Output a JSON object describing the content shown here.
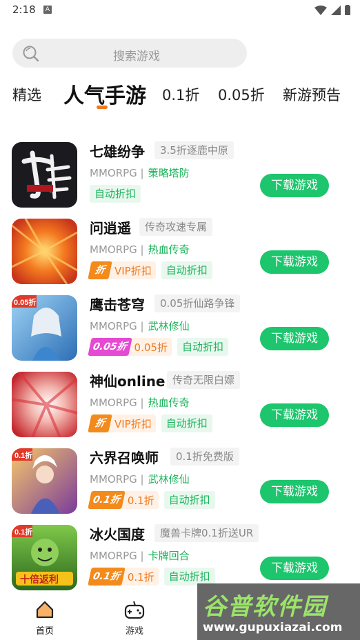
{
  "status_bar": {
    "time": "2:18",
    "notification_icon": "A"
  },
  "search": {
    "placeholder": "搜索游戏"
  },
  "tabs": [
    {
      "label": "精选"
    },
    {
      "label": "人气手游",
      "active": true
    },
    {
      "label": "0.1折"
    },
    {
      "label": "0.05折"
    },
    {
      "label": "新游预告"
    }
  ],
  "colors": {
    "accent": "#f07a1e",
    "green": "#1dc56d",
    "tag_green": "#1bb35a"
  },
  "games": [
    {
      "name": "七雄纷争",
      "tag": "3.5折逐鹿中原",
      "type": "MMORPG |",
      "genre": "策略塔防",
      "badge": "",
      "badge_value": "",
      "auto": "自动折扣",
      "button": "下载游戏",
      "icon": "qixiong-game-icon"
    },
    {
      "name": "问逍遥",
      "tag": "传奇攻速专属",
      "type": "MMORPG |",
      "genre": "热血传奇",
      "badge": "折",
      "badge_value": "VIP折扣",
      "auto": "自动折扣",
      "button": "下载游戏",
      "icon": "wenxiaoyao-game-icon"
    },
    {
      "name": "鹰击苍穹",
      "tag": "0.05折仙路争锋",
      "type": "MMORPG |",
      "genre": "武林修仙",
      "badge": "0.05折",
      "badge_value": "0.05折",
      "auto": "自动折扣",
      "button": "下载游戏",
      "icon": "yingji-game-icon"
    },
    {
      "name": "神仙online",
      "tag": "传奇无限白嫖",
      "type": "MMORPG |",
      "genre": "热血传奇",
      "badge": "折",
      "badge_value": "VIP折扣",
      "auto": "自动折扣",
      "button": "下载游戏",
      "icon": "shenxian-game-icon"
    },
    {
      "name": "六界召唤师",
      "tag": "0.1折免费版",
      "type": "MMORPG |",
      "genre": "武林修仙",
      "badge": "0.1折",
      "badge_value": "0.1折",
      "auto": "自动折扣",
      "button": "下载游戏",
      "icon": "liujie-game-icon"
    },
    {
      "name": "冰火国度",
      "tag": "魔兽卡牌0.1折送UR",
      "type": "MMORPG |",
      "genre": "卡牌回合",
      "badge": "0.1折",
      "badge_value": "0.1折",
      "auto": "自动折扣",
      "button": "下载游戏",
      "icon": "binghuo-game-icon"
    }
  ],
  "bottom_nav": [
    {
      "label": "首页",
      "icon": "home-icon",
      "active": true
    },
    {
      "label": "游戏",
      "icon": "gamepad-icon"
    }
  ],
  "watermark": {
    "title": "谷普软件园",
    "url": "www.gupuxiazai.com"
  }
}
